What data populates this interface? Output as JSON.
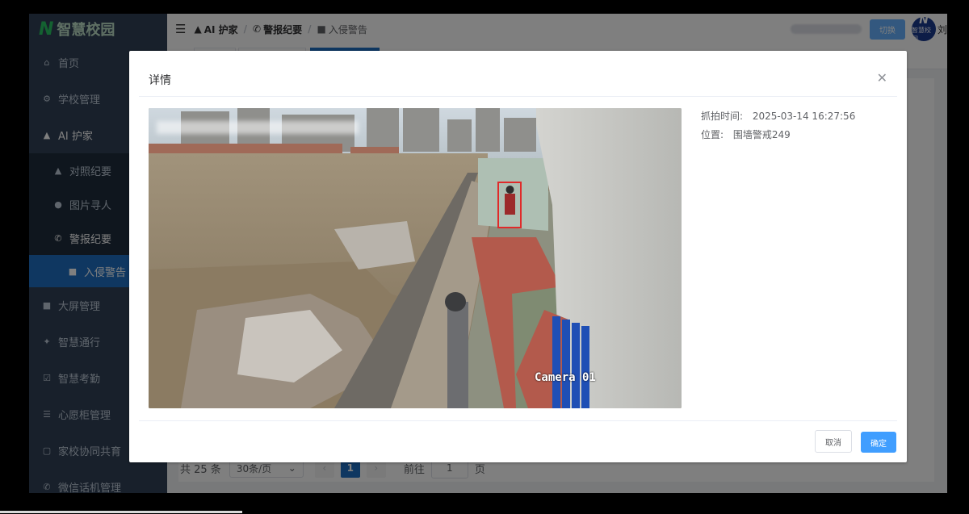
{
  "sidebar": {
    "logo_text": "智慧校园",
    "items": [
      {
        "label": "首页",
        "icon": "home-icon"
      },
      {
        "label": "学校管理",
        "icon": "settings-icon"
      },
      {
        "label": "AI 护家",
        "icon": "bell-icon"
      },
      {
        "label": "对照纪要",
        "icon": "bell-icon"
      },
      {
        "label": "图片寻人",
        "icon": "user-icon"
      },
      {
        "label": "警报纪要",
        "icon": "phone-icon"
      },
      {
        "label": "入侵警告",
        "icon": "grid-icon"
      },
      {
        "label": "大屏管理",
        "icon": "grid-icon"
      },
      {
        "label": "智慧通行",
        "icon": "walk-icon"
      },
      {
        "label": "智慧考勤",
        "icon": "check-icon"
      },
      {
        "label": "心愿柜管理",
        "icon": "list-icon"
      },
      {
        "label": "家校协同共育",
        "icon": "doc-icon"
      },
      {
        "label": "微信话机管理",
        "icon": "phone-icon"
      }
    ]
  },
  "header": {
    "breadcrumb": [
      "AI 护家",
      "警报纪要",
      "入侵警告"
    ],
    "switch_label": "切换",
    "avatar_text": "智慧校园",
    "user_char": "刘"
  },
  "pagination": {
    "total": "共 25 条",
    "page_size": "30条/页",
    "current_page": "1",
    "goto_label": "前往",
    "goto_value": "1",
    "page_suffix": "页"
  },
  "dialog": {
    "title": "详情",
    "capture_time_label": "抓拍时间:",
    "capture_time_value": "2025-03-14 16:27:56",
    "location_label": "位置:",
    "location_value": "围墙警戒249",
    "camera_label": "Camera 01",
    "cancel_label": "取消",
    "ok_label": "确定"
  },
  "colors": {
    "sidebar_bg": "#304156",
    "accent": "#1e6fc2",
    "primary_button": "#409eff"
  }
}
